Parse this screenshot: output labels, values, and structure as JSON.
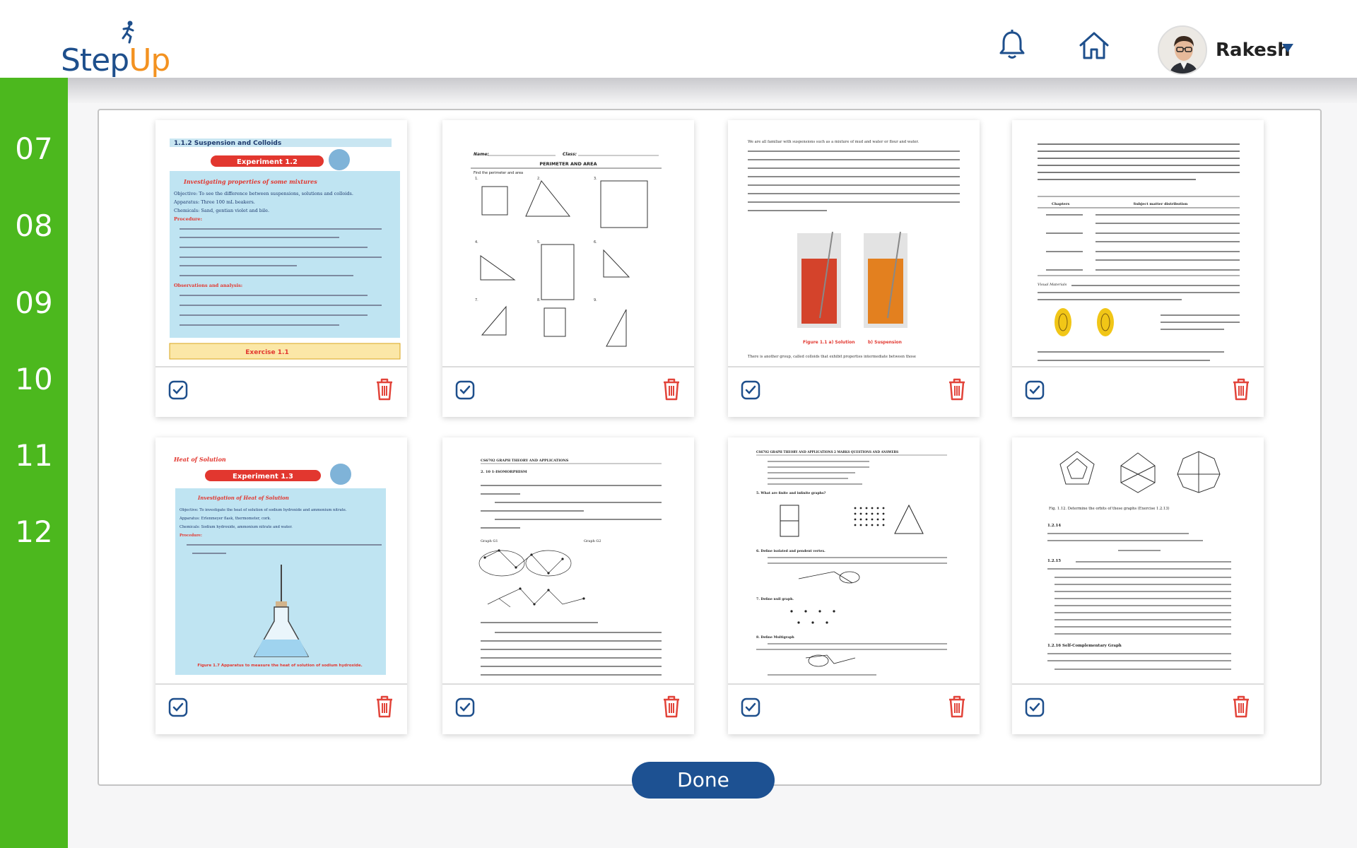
{
  "brand": {
    "part1": "Step",
    "part2": "Up"
  },
  "user": {
    "name": "Rakesh"
  },
  "sidebar": {
    "items": [
      "07",
      "08",
      "09",
      "10",
      "11",
      "12"
    ]
  },
  "cards": [
    {
      "lines": [
        "1.1.2  Suspension and Colloids",
        "Experiment 1.2",
        "Investigating properties of some mixtures",
        "Objective: To see the difference between suspensions, solutions and colloids.",
        "Apparatus: Three 100 mL beakers.",
        "Chemicals: Sand, gentian violet and bile.",
        "Procedure:",
        "Observations and analysis:",
        "Exercise 1.1"
      ]
    },
    {
      "lines": [
        "Name:",
        "Class:",
        "PERIMETER AND AREA",
        "Find the perimeter and area"
      ]
    },
    {
      "lines": [
        "We are all familiar with suspensions such as a mixture of mud and water or flour and water.",
        "Figure 1.1  a) Solution",
        "b) Suspension",
        "There is another group, called colloids that exhibit properties intermediate between those"
      ]
    },
    {
      "lines": [
        "Chapters",
        "Subject matter distribution",
        "Visual Materials"
      ]
    },
    {
      "lines": [
        "Heat of Solution",
        "Experiment 1.3",
        "Investigation of Heat of Solution",
        "Objective: To investigate the heat of solution of sodium hydroxide and ammonium nitrate.",
        "Apparatus: Erlenmeyer flask, thermometer, cork.",
        "Chemicals: Sodium hydroxide, ammonium nitrate and water.",
        "Procedure:",
        "Figure 1.7   Apparatus to measure the heat of solution of sodium hydroxide."
      ]
    },
    {
      "lines": [
        "CS6702 GRAPH THEORY AND APPLICATIONS",
        "2. 10   1-ISOMORPHISM",
        "Graph G1",
        "Graph G2"
      ]
    },
    {
      "lines": [
        "CS6702          GRAPH THEORY AND APPLICATIONS 2 MARKS QUESTIONS AND ANSWERS",
        "5. What are finite and infinite graphs?",
        "6. Define isolated and pendent vertex.",
        "7. Define null graph.",
        "8. Define Multigraph"
      ]
    },
    {
      "lines": [
        "Fig. 1.12.  Determine the orbits of these graphs (Exercise 1.2.13)",
        "1.2.14",
        "1.2.15",
        "1.2.16 Self-Complementary Graph"
      ]
    }
  ],
  "actions": {
    "done_label": "Done"
  },
  "colors": {
    "sidebar": "#4cb81e",
    "brand_blue": "#1e4f8c",
    "brand_orange": "#f39221",
    "delete_red": "#e2443a",
    "done_button": "#1d5192"
  }
}
